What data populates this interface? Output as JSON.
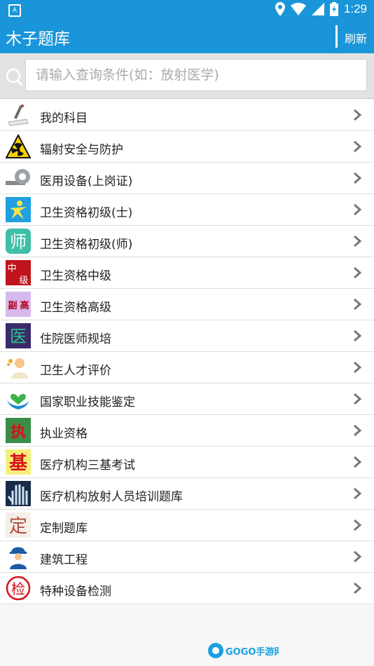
{
  "status": {
    "time": "1:29",
    "notification_icon": "A"
  },
  "appbar": {
    "title": "木子题库",
    "refresh_label": "刷新"
  },
  "search": {
    "placeholder": "请输入查询条件(如：放射医学)"
  },
  "items": [
    {
      "label": "我的科目",
      "icon": "pencil-paper-icon"
    },
    {
      "label": "辐射安全与防护",
      "icon": "radiation-icon"
    },
    {
      "label": "医用设备(上岗证)",
      "icon": "ct-scanner-icon"
    },
    {
      "label": "卫生资格初级(士)",
      "icon": "nurse-figure-icon"
    },
    {
      "label": "卫生资格初级(师)",
      "icon": "shi-character-icon"
    },
    {
      "label": "卫生资格中级",
      "icon": "zhongji-badge-icon"
    },
    {
      "label": "卫生资格高级",
      "icon": "fugao-badge-icon"
    },
    {
      "label": "住院医师规培",
      "icon": "yi-character-icon"
    },
    {
      "label": "卫生人才评价",
      "icon": "doctor-avatar-icon"
    },
    {
      "label": "国家职业技能鉴定",
      "icon": "heart-hands-icon"
    },
    {
      "label": "执业资格",
      "icon": "zhi-calligraphy-icon"
    },
    {
      "label": "医疗机构三基考试",
      "icon": "ji-character-icon"
    },
    {
      "label": "医疗机构放射人员培训题库",
      "icon": "xray-hand-icon"
    },
    {
      "label": "定制题库",
      "icon": "ding-character-icon"
    },
    {
      "label": "建筑工程",
      "icon": "worker-icon"
    },
    {
      "label": "特种设备检测",
      "icon": "jian-stamp-icon"
    }
  ],
  "watermark": {
    "text": "GOGO手游网"
  }
}
